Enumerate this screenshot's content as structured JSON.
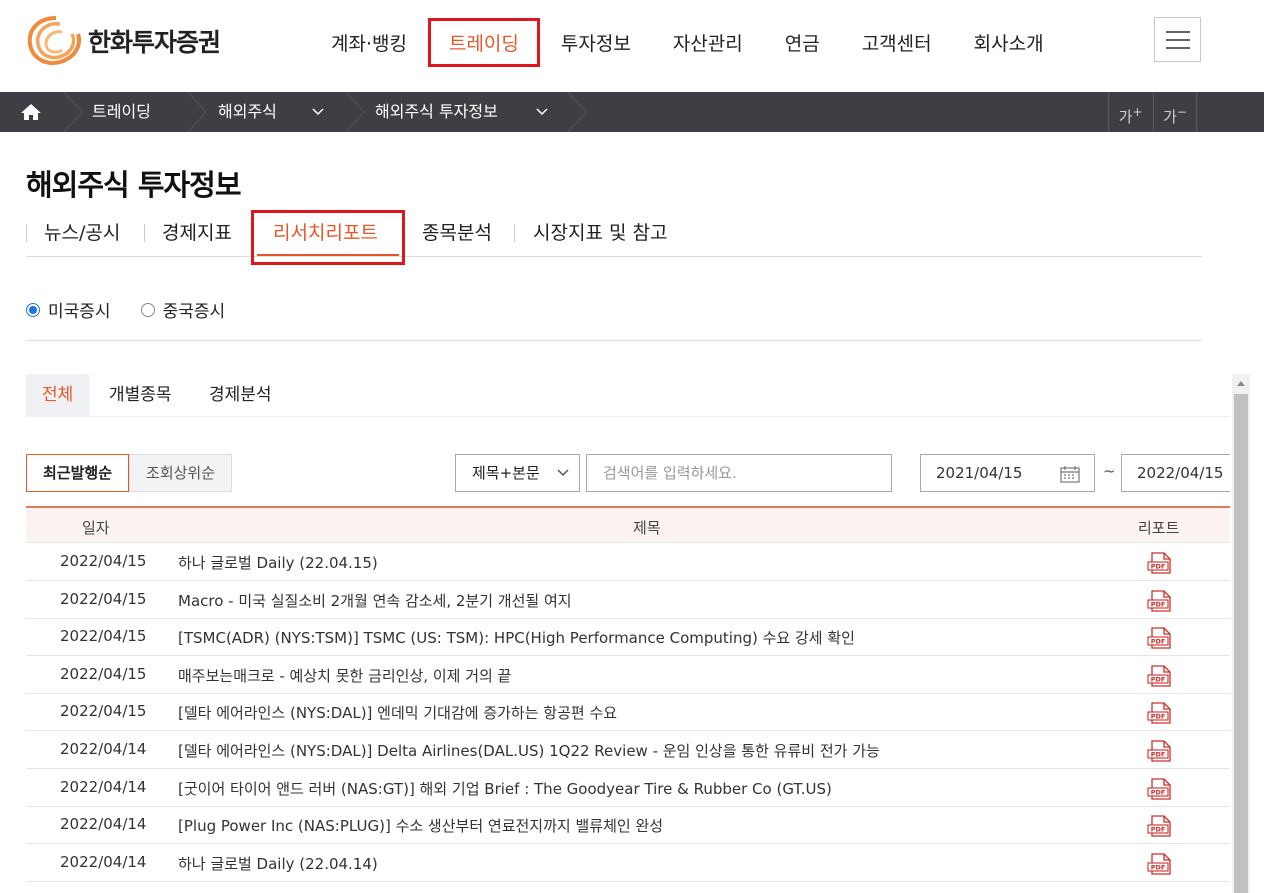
{
  "header": {
    "logo_text": "한화투자증권",
    "nav": [
      "계좌·뱅킹",
      "트레이딩",
      "투자정보",
      "자산관리",
      "연금",
      "고객센터",
      "회사소개"
    ],
    "nav_active": "트레이딩"
  },
  "breadcrumb": {
    "items": [
      "트레이딩",
      "해외주식",
      "해외주식 투자정보"
    ],
    "font_up": "가",
    "font_down": "가"
  },
  "page": {
    "title": "해외주식 투자정보",
    "tabs": [
      "뉴스/공시",
      "경제지표",
      "리서치리포트",
      "종목분석",
      "시장지표 및 참고"
    ],
    "active_tab": "리서치리포트"
  },
  "market": {
    "options": [
      "미국증시",
      "중국증시"
    ],
    "selected": "미국증시"
  },
  "subtabs": {
    "items": [
      "전체",
      "개별종목",
      "경제분석"
    ],
    "active": "전체"
  },
  "controls": {
    "sort": [
      "최근발행순",
      "조회상위순"
    ],
    "sort_active": "최근발행순",
    "search_field": "제목+본문",
    "search_placeholder": "검색어를 입력하세요.",
    "date_from": "2021/04/15",
    "date_sep": "~",
    "date_to": "2022/04/15"
  },
  "table": {
    "headers": {
      "date": "일자",
      "title": "제목",
      "report": "리포트"
    },
    "rows": [
      {
        "date": "2022/04/15",
        "title": "하나 글로벌 Daily (22.04.15)"
      },
      {
        "date": "2022/04/15",
        "title": "Macro - 미국 실질소비 2개월 연속 감소세, 2분기 개선될 여지"
      },
      {
        "date": "2022/04/15",
        "title": "[TSMC(ADR) (NYS:TSM)] TSMC (US: TSM): HPC(High Performance Computing) 수요 강세 확인"
      },
      {
        "date": "2022/04/15",
        "title": "매주보는매크로 - 예상치 못한 금리인상, 이제 거의 끝"
      },
      {
        "date": "2022/04/15",
        "title": "[델타 에어라인스 (NYS:DAL)] 엔데믹 기대감에 증가하는 항공편 수요"
      },
      {
        "date": "2022/04/14",
        "title": "[델타 에어라인스 (NYS:DAL)] Delta Airlines(DAL.US) 1Q22 Review - 운임 인상을 통한 유류비 전가 가능"
      },
      {
        "date": "2022/04/14",
        "title": "[굿이어 타이어 앤드 러버 (NAS:GT)] 해외 기업 Brief : The Goodyear Tire & Rubber Co (GT.US)"
      },
      {
        "date": "2022/04/14",
        "title": "[Plug Power Inc (NAS:PLUG)] 수소 생산부터 연료전지까지 밸류체인 완성"
      },
      {
        "date": "2022/04/14",
        "title": "하나 글로벌 Daily (22.04.14)"
      }
    ]
  },
  "colors": {
    "accent": "#e8562a",
    "highlight_box": "#e0161c",
    "breadcrumb_bg": "#3d3f44",
    "radio": "#1a73e8"
  }
}
